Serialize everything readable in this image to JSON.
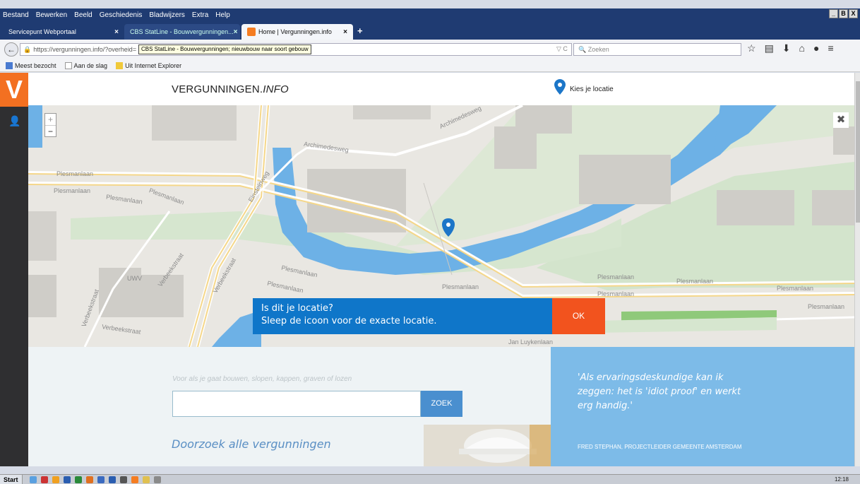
{
  "browser": {
    "menu": [
      "Bestand",
      "Bewerken",
      "Beeld",
      "Geschiedenis",
      "Bladwijzers",
      "Extra",
      "Help"
    ],
    "window_controls": [
      "_",
      "B",
      "X"
    ],
    "tabs": [
      {
        "label": "Servicepunt Webportaal",
        "close": "×"
      },
      {
        "label": "CBS StatLine - Bouwvergunningen...",
        "close": "×"
      },
      {
        "label": "Home | Vergunningen.info",
        "close": "×"
      }
    ],
    "new_tab": "+",
    "back_glyph": "←",
    "url": "https://vergunningen.info/?overheid=",
    "url_tooltip": "CBS StatLine - Bouwvergunningen; nieuwbouw naar soort gebouw",
    "url_icons": "▽ C",
    "search_placeholder": "Zoeken",
    "toolbar_icons": [
      "star-icon",
      "library-icon",
      "download-icon",
      "home-icon",
      "chat-icon",
      "menu-icon"
    ],
    "bookmarks": [
      "Meest bezocht",
      "Aan de slag",
      "Uit Internet Explorer"
    ]
  },
  "site": {
    "logo_glyph": "V",
    "brand_main": "VERGUNNINGEN.",
    "brand_italic": "INFO",
    "location_label": "Kies je locatie",
    "zoom_in": "+",
    "zoom_out": "−",
    "map_close": "✖",
    "map_labels": {
      "archimedesweg_top": "Archimedesweg",
      "archimedesweg_mid": "Archimedesweg",
      "plesmanlaan_1": "Plesmanlaan",
      "plesmanlaan_2": "Plesmanlaan",
      "plesmanlaan_3": "Plesmanlaan",
      "plesmanlaan_4": "Plesmanlaan",
      "plesmanlaan_5": "Plesmanlaan",
      "plesmanlaan_6": "Plesmanlaan",
      "plesmanlaan_7": "Plesmanlaan",
      "plesmanlaan_8": "Plesmanlaan",
      "plesmanlaan_9": "Plesmanlaan",
      "plesmanlaan_10": "Plesmanlaan",
      "plesmanlaan_11": "Plesmanlaan",
      "plesmanlaan_12": "Plesmanlaan",
      "einsteinweg": "Einsteinweg",
      "verbeekstraat_1": "Verbeekstraat",
      "verbeekstraat_2": "Verbeekstraat",
      "verbeekstraat_3": "Verbeekstraat",
      "verbeekstraat_4": "Verbeekstraat",
      "uwv": "UWV",
      "jan_luyken": "Jan Luykenlaan"
    },
    "popup_line1": "Is dit je locatie?",
    "popup_line2": "Sleep de icoon voor de exacte locatie.",
    "ok_label": "OK",
    "search_hint": "Voor als je gaat bouwen, slopen, kappen, graven of lozen",
    "search_value": "",
    "search_button": "ZOEK",
    "doorzoek": "Doorzoek alle vergunningen",
    "quote": "'Als ervaringsdeskundige kan ik zeggen: het is 'idiot proof' en werkt erg handig.'",
    "quote_author": "FRED STEPHAN, PROJECTLEIDER GEMEENTE AMSTERDAM"
  },
  "taskbar": {
    "start": "Start",
    "clock": "12:18"
  },
  "colors": {
    "brand_orange": "#f37021",
    "popup_blue": "#0f76c9",
    "ok_orange": "#f2531e",
    "quote_blue": "#7dbbe8",
    "water": "#6db1e6"
  }
}
